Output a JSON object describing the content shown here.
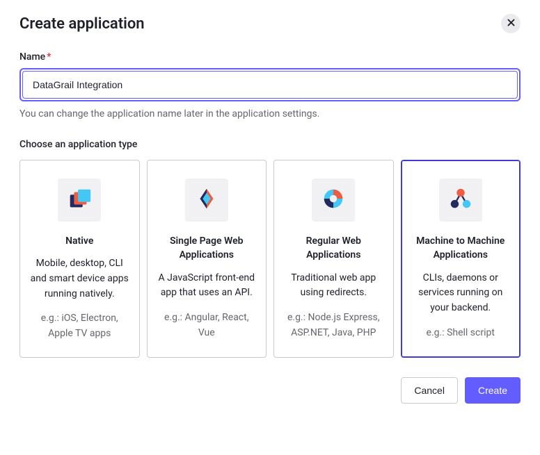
{
  "modal": {
    "title": "Create application",
    "name_label": "Name",
    "name_value": "DataGrail Integration",
    "name_hint": "You can change the application name later in the application settings.",
    "type_label": "Choose an application type",
    "cancel_label": "Cancel",
    "create_label": "Create"
  },
  "cards": [
    {
      "title": "Native",
      "desc": "Mobile, desktop, CLI and smart device apps running natively.",
      "example": "e.g.: iOS, Electron, Apple TV apps"
    },
    {
      "title": "Single Page Web Applications",
      "desc": "A JavaScript front-end app that uses an API.",
      "example": "e.g.: Angular, React, Vue"
    },
    {
      "title": "Regular Web Applications",
      "desc": "Traditional web app using redirects.",
      "example": "e.g.: Node.js Express, ASP.NET, Java, PHP"
    },
    {
      "title": "Machine to Machine Applications",
      "desc": "CLIs, daemons or services running on your backend.",
      "example": "e.g.: Shell script"
    }
  ]
}
